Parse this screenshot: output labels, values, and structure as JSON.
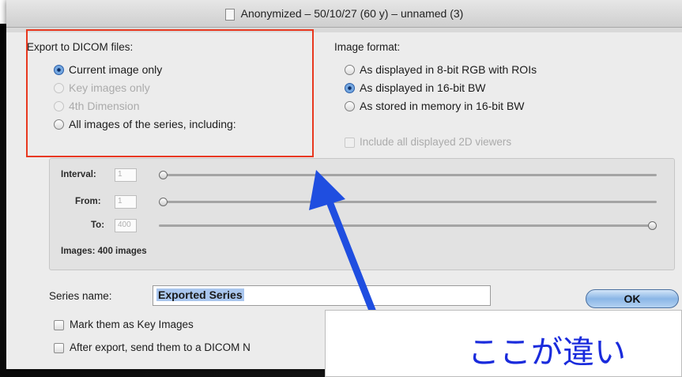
{
  "window": {
    "title": "Anonymized – 50/10/27 (60 y) – unnamed (3)"
  },
  "export_section": {
    "heading": "Export to DICOM files:",
    "options": [
      {
        "label": "Current image only",
        "selected": true,
        "enabled": true
      },
      {
        "label": "Key images only",
        "selected": false,
        "enabled": false
      },
      {
        "label": "4th Dimension",
        "selected": false,
        "enabled": false
      },
      {
        "label": "All images of the series, including:",
        "selected": false,
        "enabled": true
      }
    ]
  },
  "image_format": {
    "heading": "Image format:",
    "options": [
      {
        "label": "As displayed in 8-bit RGB with ROIs",
        "selected": false
      },
      {
        "label": "As displayed in 16-bit BW",
        "selected": true
      },
      {
        "label": "As stored in memory in 16-bit BW",
        "selected": false
      }
    ],
    "include_viewers": {
      "label": "Include all displayed 2D viewers",
      "checked": false,
      "enabled": false
    }
  },
  "range": {
    "interval": {
      "label": "Interval:",
      "value": "1",
      "slider_fraction": 0.0
    },
    "from": {
      "label": "From:",
      "value": "1",
      "slider_fraction": 0.0
    },
    "to": {
      "label": "To:",
      "value": "400",
      "slider_fraction": 1.0
    },
    "images_count": "Images: 400 images"
  },
  "series": {
    "label": "Series name:",
    "value": "Exported Series"
  },
  "ok_button": "OK",
  "checkboxes": {
    "mark_key": "Mark them as Key Images",
    "send_after": "After export, send them to a DICOM N"
  },
  "annotation": {
    "callout_text": "ここが違い",
    "highlight_color": "#e8381f",
    "arrow_color": "#1f4ee0"
  }
}
